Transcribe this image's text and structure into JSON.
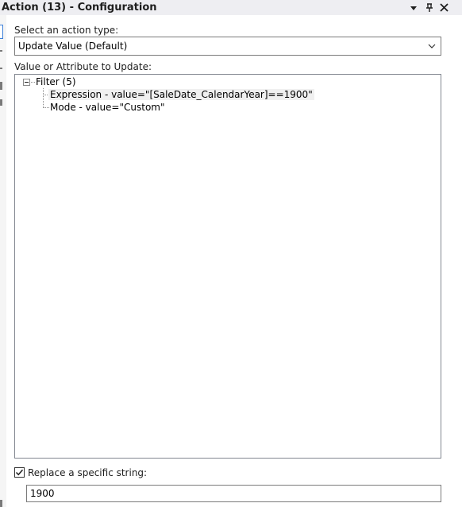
{
  "window": {
    "title": "Action (13) - Configuration"
  },
  "action_type": {
    "label": "Select an action type:",
    "selected": "Update Value (Default)"
  },
  "value_to_update": {
    "label": "Value or Attribute to Update:",
    "tree": {
      "root": "Filter (5)",
      "children": [
        "Expression - value=\"[SaleDate_CalendarYear]==1900\"",
        "Mode - value=\"Custom\""
      ]
    }
  },
  "replace": {
    "label": "Replace a specific string:",
    "checked": true,
    "value": "1900"
  },
  "icons": {
    "dropdown": "chevron-down-icon",
    "pin": "pin-icon",
    "close": "close-icon"
  }
}
